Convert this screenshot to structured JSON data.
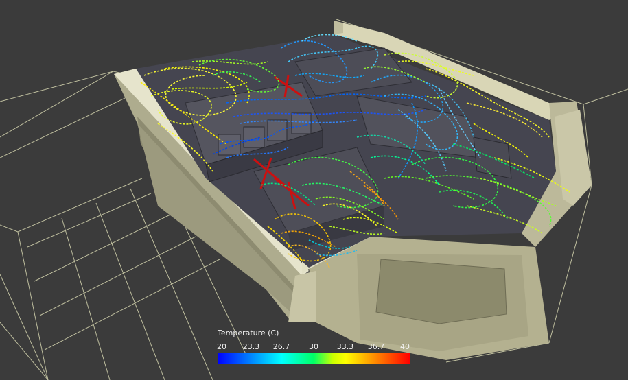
{
  "legend": {
    "title": "Temperature (C)",
    "min": 20,
    "max": 40,
    "ticks": [
      "20",
      "23.3",
      "26.7",
      "30",
      "33.3",
      "36.7",
      "40"
    ],
    "colors": [
      "#0000ff",
      "#0080ff",
      "#00ffff",
      "#00ff66",
      "#ccff00",
      "#ffff00",
      "#ff8000",
      "#ff0000"
    ]
  },
  "scene": {
    "background": "#3b3b3b",
    "wireframe_color": "#d8d8b8",
    "wall_color": "#c9c6a6",
    "rack_color": "#4a4a52"
  }
}
